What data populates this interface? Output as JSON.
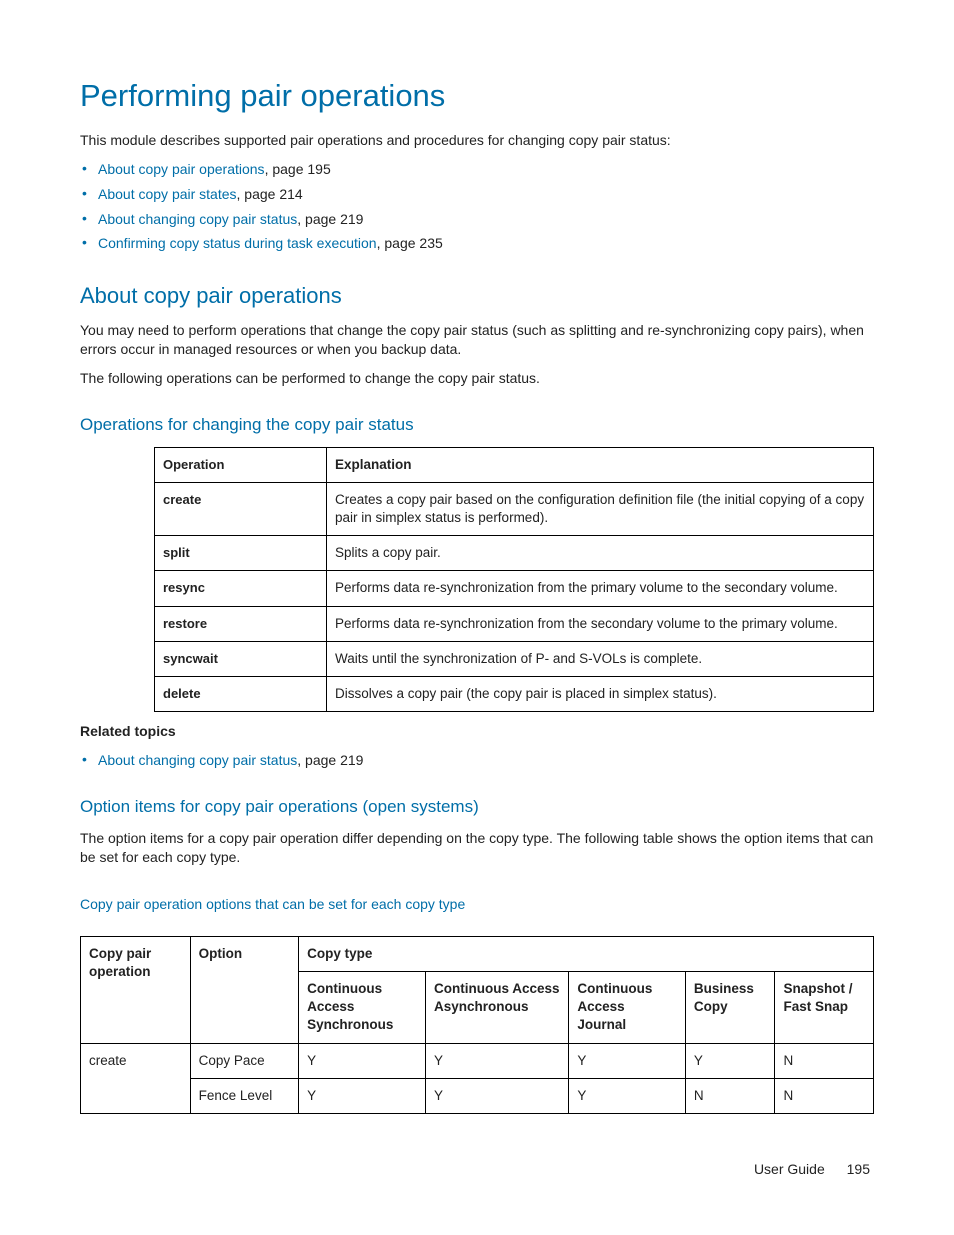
{
  "title": "Performing pair operations",
  "intro": "This module describes supported pair operations and procedures for changing copy pair status:",
  "toc": [
    {
      "link": "About copy pair operations",
      "suffix": ", page 195"
    },
    {
      "link": "About copy pair states",
      "suffix": ", page 214"
    },
    {
      "link": "About changing copy pair status",
      "suffix": ", page 219"
    },
    {
      "link": "Confirming copy status during task execution",
      "suffix": ", page 235"
    }
  ],
  "section1": {
    "heading": "About copy pair operations",
    "p1": "You may need to perform operations that change the copy pair status (such as splitting and re-synchronizing copy pairs), when errors occur in managed resources or when you backup data.",
    "p2": "The following operations can be performed to change the copy pair status."
  },
  "table1": {
    "heading": "Operations for changing the copy pair status",
    "header": {
      "c1": "Operation",
      "c2": "Explanation"
    },
    "rows": [
      {
        "op": "create",
        "exp": "Creates a copy pair based on the configuration definition file (the initial copying of a copy pair in simplex status is performed)."
      },
      {
        "op": "split",
        "exp": "Splits a copy pair."
      },
      {
        "op": "resync",
        "exp": "Performs data re-synchronization from the primary volume to the secondary volume."
      },
      {
        "op": "restore",
        "exp": "Performs data re-synchronization from the secondary volume to the primary volume."
      },
      {
        "op": "syncwait",
        "exp": "Waits until the synchronization of P- and S-VOLs is complete."
      },
      {
        "op": "delete",
        "exp": "Dissolves a copy pair (the copy pair is placed in simplex status)."
      }
    ]
  },
  "related": {
    "title": "Related topics",
    "items": [
      {
        "link": "About changing copy pair status",
        "suffix": ", page 219"
      }
    ]
  },
  "section2": {
    "heading": "Option items for copy pair operations (open systems)",
    "p1": "The option items for a copy pair operation differ depending on the copy type. The following table shows the option items that can be set for each copy type."
  },
  "table2": {
    "heading": "Copy pair operation options that can be set for each copy type",
    "header": {
      "colA": "Copy pair operation",
      "colB": "Option",
      "group": "Copy type",
      "c1": "Continuous Access Synchronous",
      "c2": "Continuous Access Asynchronous",
      "c3": "Continuous Access Journal",
      "c4": "Business Copy",
      "c5": "Snapshot / Fast Snap"
    },
    "groupOp": "create",
    "rows": [
      {
        "opt": "Copy Pace",
        "v": [
          "Y",
          "Y",
          "Y",
          "Y",
          "N"
        ]
      },
      {
        "opt": "Fence Level",
        "v": [
          "Y",
          "Y",
          "Y",
          "N",
          "N"
        ]
      }
    ]
  },
  "footer": {
    "label": "User Guide",
    "page": "195"
  }
}
